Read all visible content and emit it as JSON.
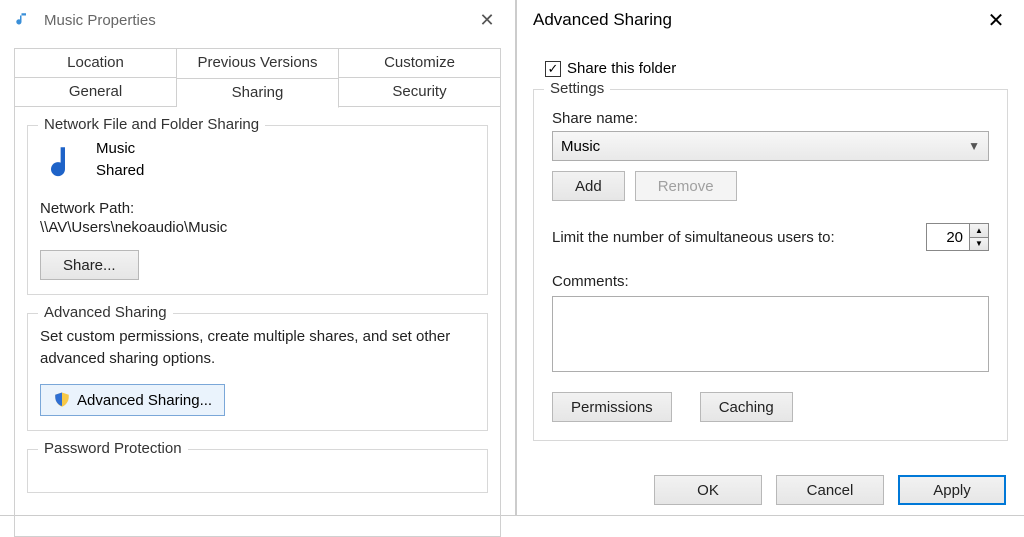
{
  "left": {
    "title": "Music Properties",
    "tabs": {
      "location": "Location",
      "previous": "Previous Versions",
      "customize": "Customize",
      "general": "General",
      "sharing": "Sharing",
      "security": "Security"
    },
    "network_group_title": "Network File and Folder Sharing",
    "folder_name": "Music",
    "share_state": "Shared",
    "network_path_label": "Network Path:",
    "network_path": "\\\\AV\\Users\\nekoaudio\\Music",
    "share_button": "Share...",
    "advanced_group_title": "Advanced Sharing",
    "advanced_desc": "Set custom permissions, create multiple shares, and set other advanced sharing options.",
    "advanced_button": "Advanced Sharing...",
    "password_group_title": "Password Protection"
  },
  "right": {
    "title": "Advanced Sharing",
    "share_checkbox": "Share this folder",
    "share_checked": true,
    "settings_title": "Settings",
    "share_name_label": "Share name:",
    "share_name_value": "Music",
    "add": "Add",
    "remove": "Remove",
    "limit_label": "Limit the number of simultaneous users to:",
    "limit_value": "20",
    "comments_label": "Comments:",
    "comments_value": "",
    "permissions": "Permissions",
    "caching": "Caching",
    "ok": "OK",
    "cancel": "Cancel",
    "apply": "Apply"
  }
}
